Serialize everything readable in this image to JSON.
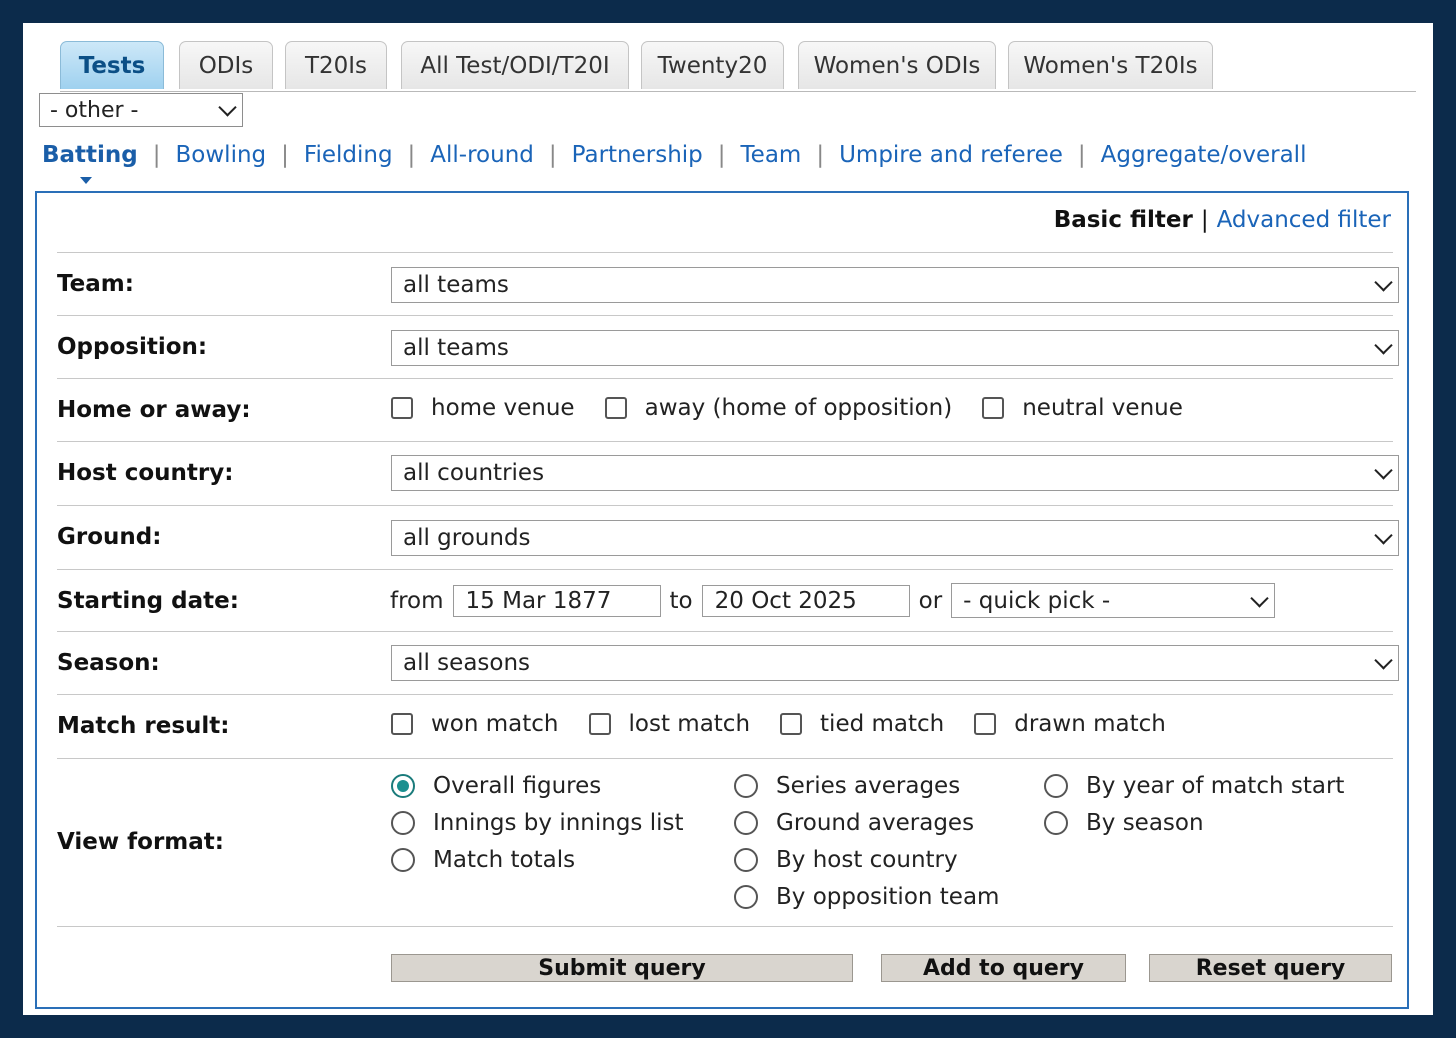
{
  "tabs": [
    "Tests",
    "ODIs",
    "T20Is",
    "All Test/ODI/T20I",
    "Twenty20",
    "Women's ODIs",
    "Women's T20Is"
  ],
  "other_select": "- other -",
  "subnav": [
    "Batting",
    "Bowling",
    "Fielding",
    "All-round",
    "Partnership",
    "Team",
    "Umpire and referee",
    "Aggregate/overall"
  ],
  "filter": {
    "basic": "Basic filter",
    "separator": "|",
    "advanced": "Advanced filter"
  },
  "team": {
    "label": "Team:",
    "value": "all teams"
  },
  "opposition": {
    "label": "Opposition:",
    "value": "all teams"
  },
  "home_away": {
    "label": "Home or away:",
    "options": [
      "home venue",
      "away (home of opposition)",
      "neutral venue"
    ]
  },
  "host_country": {
    "label": "Host country:",
    "value": "all countries"
  },
  "ground": {
    "label": "Ground:",
    "value": "all grounds"
  },
  "starting_date": {
    "label": "Starting date:",
    "from_text": "from",
    "from": "15 Mar 1877",
    "to_text": "to",
    "to": "20 Oct 2025",
    "or_text": "or",
    "quick_pick": "- quick pick -"
  },
  "season": {
    "label": "Season:",
    "value": "all seasons"
  },
  "match_result": {
    "label": "Match result:",
    "options": [
      "won match",
      "lost match",
      "tied match",
      "drawn match"
    ]
  },
  "view_format": {
    "label": "View format:",
    "col1": [
      "Overall figures",
      "Innings by innings list",
      "Match totals"
    ],
    "col2": [
      "Series averages",
      "Ground averages",
      "By host country",
      "By opposition team"
    ],
    "col3": [
      "By year of match start",
      "By season"
    ],
    "selected": "Overall figures"
  },
  "buttons": {
    "submit": "Submit query",
    "add": "Add to query",
    "reset": "Reset query"
  }
}
